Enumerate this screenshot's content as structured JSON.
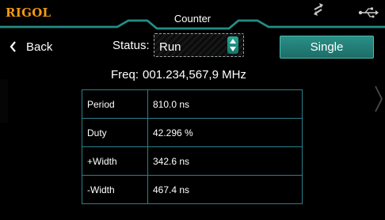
{
  "header": {
    "logo": "RIGOL",
    "title": "Counter",
    "icons": [
      "swap-arrows-icon",
      "usb-icon"
    ],
    "accent_color": "#1f8f87"
  },
  "nav": {
    "back_label": "Back",
    "next_icon": "chevron-right-icon"
  },
  "status": {
    "label": "Status:",
    "value": "Run"
  },
  "single_button": {
    "label": "Single"
  },
  "frequency": {
    "label": "Freq:",
    "value": "001.234,567,9 MHz"
  },
  "measurements": [
    {
      "name": "Period",
      "value": "810.0 ns"
    },
    {
      "name": "Duty",
      "value": "42.296 %"
    },
    {
      "name": "+Width",
      "value": "342.6 ns"
    },
    {
      "name": "-Width",
      "value": "467.4 ns"
    }
  ]
}
